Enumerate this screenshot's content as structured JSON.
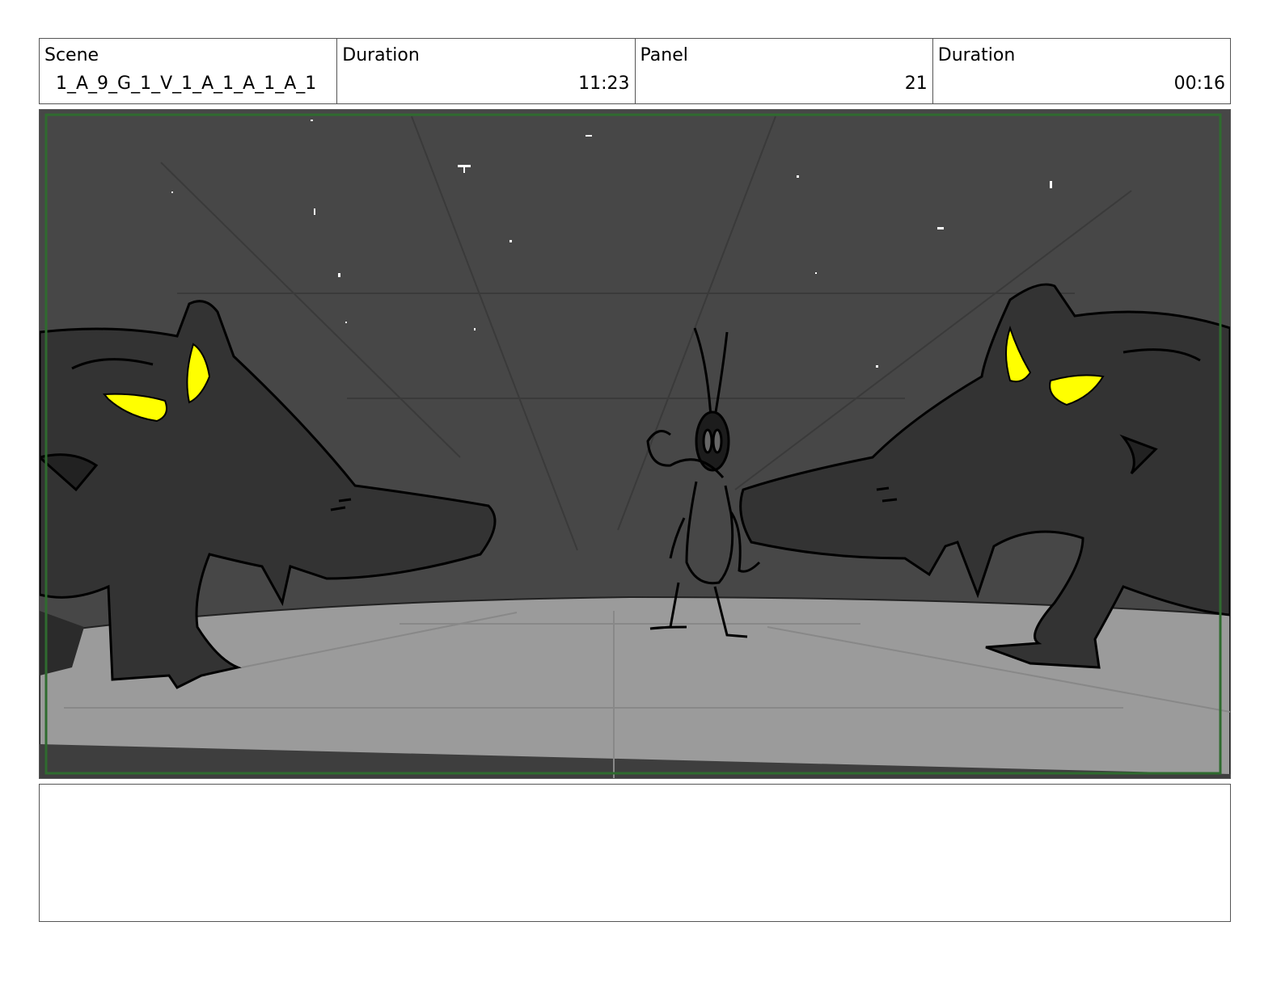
{
  "header": {
    "scene_label": "Scene",
    "scene_value": "1_A_9_G_1_V_1_A_1_A_1_A_1",
    "scene_duration_label": "Duration",
    "scene_duration_value": "11:23",
    "panel_label": "Panel",
    "panel_value": "21",
    "panel_duration_label": "Duration",
    "panel_duration_value": "00:16"
  },
  "panel_image": {
    "icon": "storyboard-sketch",
    "colors": {
      "sky": "#474747",
      "ground": "#9b9b9b",
      "creature": "#333333",
      "eyes": "#ffff00",
      "safe_frame": "#2f6b2f"
    }
  },
  "notes": {
    "text": ""
  }
}
